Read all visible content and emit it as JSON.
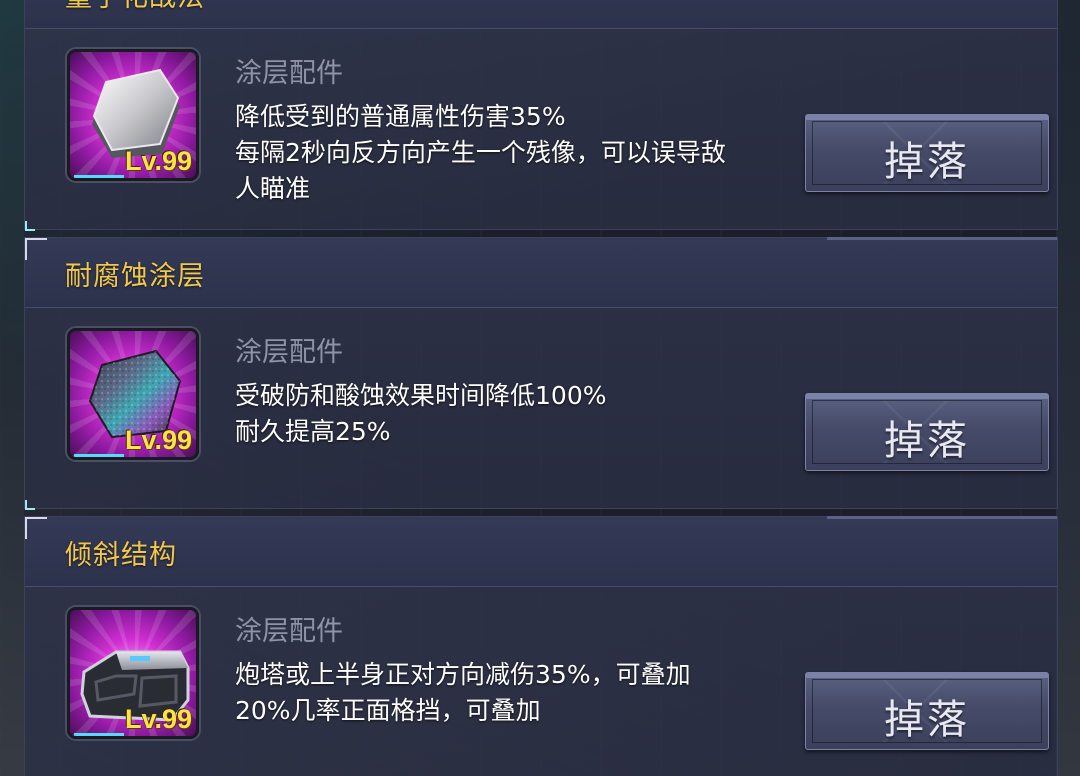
{
  "items": [
    {
      "title": "量子化战法",
      "type": "涂层配件",
      "desc": [
        "降低受到的普通属性伤害35%",
        "每隔2秒向反方向产生一个残像，可以误导敌",
        "人瞄准"
      ],
      "level": "Lv.99",
      "button": "掉落",
      "icon": "silver-armor-plate-icon"
    },
    {
      "title": "耐腐蚀涂层",
      "type": "涂层配件",
      "desc": [
        "受破防和酸蚀效果时间降低100%",
        "耐久提高25%"
      ],
      "level": "Lv.99",
      "button": "掉落",
      "icon": "iridescent-plate-icon"
    },
    {
      "title": "倾斜结构",
      "type": "涂层配件",
      "desc": [
        "炮塔或上半身正对方向减伤35%，可叠加",
        "20%几率正面格挡，可叠加"
      ],
      "level": "Lv.99",
      "button": "掉落",
      "icon": "sloped-armor-block-icon"
    }
  ],
  "colors": {
    "title": "#f2c84a",
    "type": "#8e93a8",
    "desc": "#ffffff",
    "level": "#ffe14a",
    "icon_bg": "#d12fd2"
  }
}
